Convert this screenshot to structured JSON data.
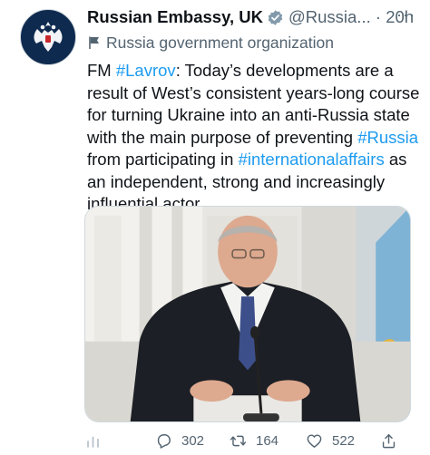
{
  "author": {
    "display_name": "Russian Embassy, UK",
    "handle": "@Russia...",
    "separator": "·",
    "time": "20h",
    "label": "Russia government organization",
    "more_icon": "more-horizontal-icon"
  },
  "tweet": {
    "lines": [
      [
        {
          "t": "FM ",
          "link": false
        },
        {
          "t": "#Lavrov",
          "link": true
        },
        {
          "t": ": Today’s developments are a",
          "link": false
        }
      ],
      [
        {
          "t": "result of West’s consistent years-long course",
          "link": false
        }
      ],
      [
        {
          "t": "for turning Ukraine into an anti-Russia state",
          "link": false
        }
      ],
      [
        {
          "t": "with the main purpose of preventing ",
          "link": false
        },
        {
          "t": "#Russia",
          "link": true
        }
      ],
      [
        {
          "t": "from participating in ",
          "link": false
        },
        {
          "t": "#internationalaffairs",
          "link": true
        },
        {
          "t": " as",
          "link": false
        }
      ],
      [
        {
          "t": "an independent, strong and increasingly",
          "link": false
        }
      ],
      [
        {
          "t": "influential actor.",
          "link": false
        }
      ]
    ]
  },
  "actions": {
    "replies": "302",
    "retweets": "164",
    "likes": "522"
  },
  "colors": {
    "link": "#1d9bf0",
    "secondary": "#536471",
    "verified_badge": "#829aab"
  }
}
